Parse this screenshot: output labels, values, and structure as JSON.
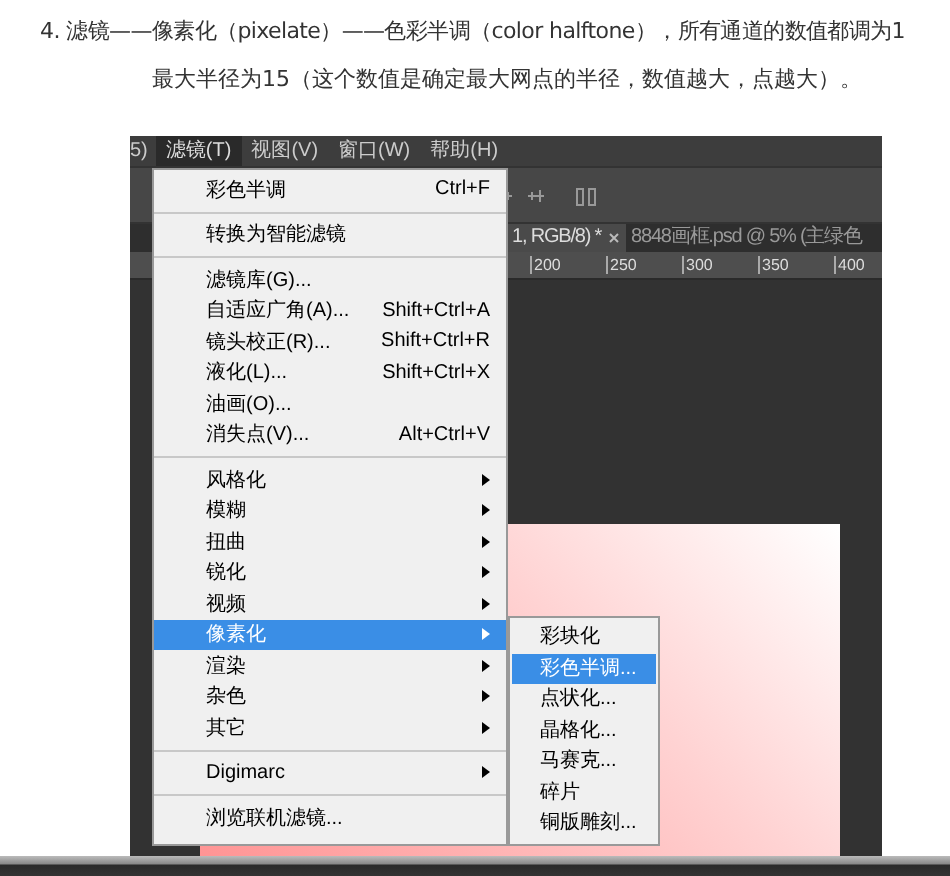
{
  "article": {
    "lines": [
      "4. 滤镜——像素化（pixelate）——色彩半调（color halftone），所有通道的数值都调为1",
      "最大半径为15（这个数值是确定最大网点的半径，数值越大，点越大）。"
    ]
  },
  "screenshot": {
    "menubar": [
      {
        "label": "5)",
        "selected": false
      },
      {
        "label": "滤镜(T)",
        "selected": true
      },
      {
        "label": "视图(V)",
        "selected": false
      },
      {
        "label": "窗口(W)",
        "selected": false
      },
      {
        "label": "帮助(H)",
        "selected": false
      }
    ],
    "document_tabs": [
      {
        "label": "1, RGB/8) *",
        "selected": true
      },
      {
        "label": "8848画框.psd @ 5% (主绿色",
        "selected": false
      }
    ],
    "ruler": [
      "200",
      "250",
      "300",
      "350",
      "400"
    ],
    "filter_menu": {
      "groups": [
        [
          {
            "label": "彩色半调",
            "shortcut": "Ctrl+F",
            "has_submenu": false,
            "selected": false
          }
        ],
        [
          {
            "label": "转换为智能滤镜",
            "has_submenu": false,
            "selected": false
          }
        ],
        [
          {
            "label": "滤镜库(G)...",
            "has_submenu": false,
            "selected": false
          },
          {
            "label": "自适应广角(A)...",
            "shortcut": "Shift+Ctrl+A",
            "has_submenu": false,
            "selected": false
          },
          {
            "label": "镜头校正(R)...",
            "shortcut": "Shift+Ctrl+R",
            "has_submenu": false,
            "selected": false
          },
          {
            "label": "液化(L)...",
            "shortcut": "Shift+Ctrl+X",
            "has_submenu": false,
            "selected": false
          },
          {
            "label": "油画(O)...",
            "has_submenu": false,
            "selected": false
          },
          {
            "label": "消失点(V)...",
            "shortcut": "Alt+Ctrl+V",
            "has_submenu": false,
            "selected": false
          }
        ],
        [
          {
            "label": "风格化",
            "has_submenu": true,
            "selected": false
          },
          {
            "label": "模糊",
            "has_submenu": true,
            "selected": false
          },
          {
            "label": "扭曲",
            "has_submenu": true,
            "selected": false
          },
          {
            "label": "锐化",
            "has_submenu": true,
            "selected": false
          },
          {
            "label": "视频",
            "has_submenu": true,
            "selected": false
          },
          {
            "label": "像素化",
            "has_submenu": true,
            "selected": true
          },
          {
            "label": "渲染",
            "has_submenu": true,
            "selected": false
          },
          {
            "label": "杂色",
            "has_submenu": true,
            "selected": false
          },
          {
            "label": "其它",
            "has_submenu": true,
            "selected": false
          }
        ],
        [
          {
            "label": "Digimarc",
            "has_submenu": true,
            "selected": false
          }
        ],
        [
          {
            "label": "浏览联机滤镜...",
            "has_submenu": false,
            "selected": false
          }
        ]
      ]
    },
    "pixelate_submenu": [
      {
        "label": "彩块化",
        "selected": false
      },
      {
        "label": "彩色半调...",
        "selected": true
      },
      {
        "label": "点状化...",
        "selected": false
      },
      {
        "label": "晶格化...",
        "selected": false
      },
      {
        "label": "马赛克...",
        "selected": false
      },
      {
        "label": "碎片",
        "selected": false
      },
      {
        "label": "铜版雕刻...",
        "selected": false
      }
    ]
  }
}
